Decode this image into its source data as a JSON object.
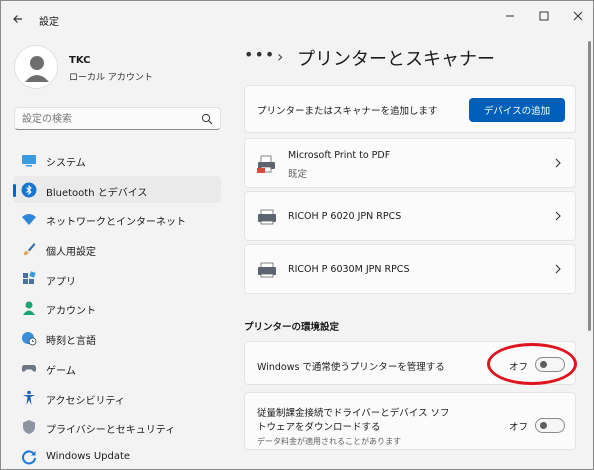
{
  "window": {
    "title": "設定"
  },
  "profile": {
    "name": "TKC",
    "account_type": "ローカル アカウント"
  },
  "search": {
    "placeholder": "設定の検索"
  },
  "nav": {
    "items": [
      {
        "label": "システム",
        "icon": "system-icon",
        "active": false
      },
      {
        "label": "Bluetooth とデバイス",
        "icon": "bluetooth-icon",
        "active": true
      },
      {
        "label": "ネットワークとインターネット",
        "icon": "wifi-icon",
        "active": false
      },
      {
        "label": "個人用設定",
        "icon": "brush-icon",
        "active": false
      },
      {
        "label": "アプリ",
        "icon": "apps-icon",
        "active": false
      },
      {
        "label": "アカウント",
        "icon": "account-icon",
        "active": false
      },
      {
        "label": "時刻と言語",
        "icon": "globe-clock-icon",
        "active": false
      },
      {
        "label": "ゲーム",
        "icon": "gamepad-icon",
        "active": false
      },
      {
        "label": "アクセシビリティ",
        "icon": "accessibility-icon",
        "active": false
      },
      {
        "label": "プライバシーとセキュリティ",
        "icon": "shield-icon",
        "active": false
      },
      {
        "label": "Windows Update",
        "icon": "update-icon",
        "active": false
      }
    ]
  },
  "breadcrumb": {
    "more": "•••",
    "separator": "›",
    "title": "プリンターとスキャナー"
  },
  "add_device": {
    "text": "プリンターまたはスキャナーを追加します",
    "button_label": "デバイスの追加"
  },
  "printers": [
    {
      "name": "Microsoft Print to PDF",
      "sub": "既定"
    },
    {
      "name": "RICOH P 6020 JPN RPCS",
      "sub": ""
    },
    {
      "name": "RICOH P 6030M JPN RPCS",
      "sub": ""
    }
  ],
  "preferences": {
    "section_title": "プリンターの環境設定",
    "manage_default": {
      "label": "Windows で通常使うプリンターを管理する",
      "state_text": "オフ",
      "on": false
    },
    "metered_download": {
      "label_line1": "従量制課金接続でドライバーとデバイス ソフ",
      "label_line2": "トウェアをダウンロードする",
      "note": "データ料金が適用されることがあります",
      "state_text": "オフ",
      "on": false
    }
  },
  "colors": {
    "accent": "#005fb8",
    "highlight": "#e0141e",
    "background": "#f3f3f3",
    "card": "#fbfbfb"
  }
}
